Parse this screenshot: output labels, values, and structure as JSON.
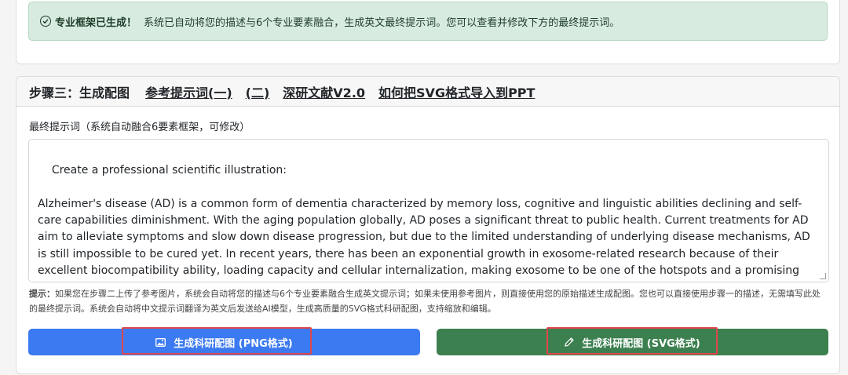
{
  "alert": {
    "title": "专业框架已生成！",
    "message": "系统已自动将您的描述与6个专业要素融合，生成英文最终提示词。您可以查看并修改下方的最终提示词。"
  },
  "step3": {
    "title": "步骤三：生成配图",
    "links": [
      "参考提示词(一)",
      "(二)",
      "深研文献V2.0",
      "如何把SVG格式导入到PPT"
    ],
    "prompt_label": "最终提示词（系统自动融合6要素框架，可修改）",
    "prompt_value": "Create a professional scientific illustration:\n\nAlzheimer's disease (AD) is a common form of dementia characterized by memory loss, cognitive and linguistic abilities declining and self-care capabilities diminishment. With the aging population globally, AD poses a significant threat to public health. Current treatments for AD aim to alleviate symptoms and slow down disease progression, but due to the limited understanding of underlying disease mechanisms, AD is still impossible to be cured yet. In recent years, there has been an exponential growth in exosome-related research because of their excellent biocompatibility ability, loading capacity and cellular internalization, making exosome to be one of the hotspots and a promising strategy in AD therapy research. This comprehensive review systematically explores the potential roles of various exosome-based nanotherapeutic strategy in AD treatment, with a particular focus on their specific",
    "hint_label": "提示：",
    "hint_text": "如果您在步骤二上传了参考图片，系统会自动将您的描述与6个专业要素融合生成英文提示词；如果未使用参考图片，则直接使用您的原始描述生成配图。您也可以直接使用步骤一的描述，无需填写此处的最终提示词。系统会自动将中文提示词翻译为英文后发送给AI模型，生成高质量的SVG格式科研配图，支持缩放和编辑。",
    "btn_png": "生成科研配图 (PNG格式)",
    "btn_svg": "生成科研配图 (SVG格式)"
  },
  "colors": {
    "png_button": "#3b7af0",
    "svg_button": "#3d8050",
    "highlight": "#e0464c",
    "alert_bg": "#d8ebe0"
  },
  "icons": [
    "check-circle-icon",
    "image-icon",
    "pen-icon"
  ]
}
